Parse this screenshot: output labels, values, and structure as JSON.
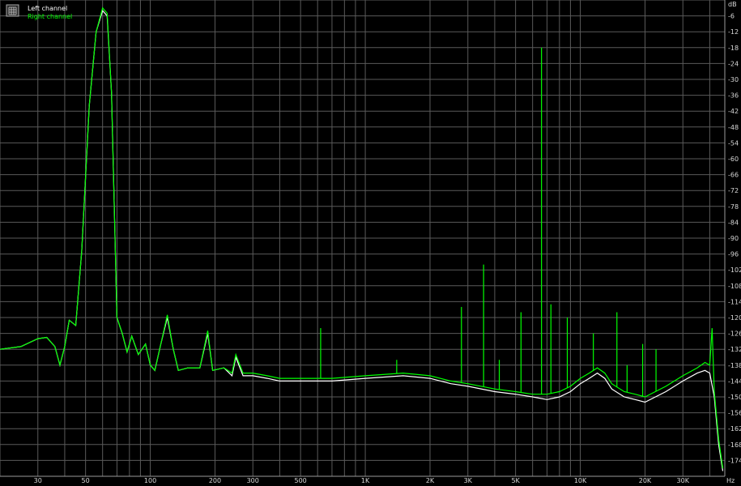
{
  "chart_data": {
    "type": "line",
    "legend": {
      "placement": "top-left",
      "icon": "grid-icon",
      "entries": [
        {
          "name": "Left channel",
          "color": "#ffffff"
        },
        {
          "name": "Right channel",
          "color": "#00ff00"
        }
      ]
    },
    "x_unit": "Hz",
    "y_unit": "dB",
    "x_scale": "log",
    "xlim": [
      20,
      47000
    ],
    "ylim": [
      -180,
      0
    ],
    "grid": true,
    "x_ticks": [
      {
        "value": 30,
        "label": "30"
      },
      {
        "value": 50,
        "label": "50"
      },
      {
        "value": 100,
        "label": "100"
      },
      {
        "value": 200,
        "label": "200"
      },
      {
        "value": 300,
        "label": "300"
      },
      {
        "value": 500,
        "label": "500"
      },
      {
        "value": 1000,
        "label": "1K"
      },
      {
        "value": 2000,
        "label": "2K"
      },
      {
        "value": 3000,
        "label": "3K"
      },
      {
        "value": 5000,
        "label": "5K"
      },
      {
        "value": 10000,
        "label": "10K"
      },
      {
        "value": 20000,
        "label": "20K"
      },
      {
        "value": 30000,
        "label": "30K"
      }
    ],
    "y_ticks": [
      -6,
      -12,
      -18,
      -24,
      -30,
      -36,
      -42,
      -48,
      -54,
      -60,
      -66,
      -72,
      -78,
      -84,
      -90,
      -96,
      -102,
      -108,
      -114,
      -120,
      -126,
      -132,
      -138,
      -144,
      -150,
      -156,
      -162,
      -168,
      -174
    ],
    "series": [
      {
        "name": "Left channel",
        "color": "#ffffff",
        "points": [
          [
            20,
            -132
          ],
          [
            25,
            -131
          ],
          [
            30,
            -128
          ],
          [
            33,
            -127.5
          ],
          [
            36,
            -131
          ],
          [
            38,
            -138
          ],
          [
            40,
            -131
          ],
          [
            42,
            -121
          ],
          [
            45,
            -123
          ],
          [
            48,
            -95
          ],
          [
            52,
            -40
          ],
          [
            56,
            -12
          ],
          [
            60,
            -4
          ],
          [
            63,
            -6
          ],
          [
            66,
            -35
          ],
          [
            70,
            -120
          ],
          [
            74,
            -126
          ],
          [
            78,
            -133
          ],
          [
            82,
            -127
          ],
          [
            88,
            -134
          ],
          [
            95,
            -130
          ],
          [
            100,
            -138
          ],
          [
            105,
            -140
          ],
          [
            112,
            -130
          ],
          [
            120,
            -120
          ],
          [
            128,
            -132
          ],
          [
            135,
            -140
          ],
          [
            150,
            -139
          ],
          [
            170,
            -139
          ],
          [
            185,
            -126
          ],
          [
            195,
            -140
          ],
          [
            220,
            -139
          ],
          [
            240,
            -142
          ],
          [
            250,
            -135
          ],
          [
            270,
            -142
          ],
          [
            300,
            -142
          ],
          [
            350,
            -143
          ],
          [
            400,
            -144
          ],
          [
            500,
            -144
          ],
          [
            700,
            -144
          ],
          [
            1000,
            -143
          ],
          [
            1500,
            -142
          ],
          [
            2000,
            -143
          ],
          [
            2500,
            -145
          ],
          [
            3000,
            -146
          ],
          [
            4000,
            -148
          ],
          [
            5000,
            -149
          ],
          [
            6000,
            -150
          ],
          [
            7000,
            -151
          ],
          [
            8000,
            -150
          ],
          [
            9000,
            -148
          ],
          [
            10000,
            -145
          ],
          [
            11000,
            -143
          ],
          [
            12000,
            -141
          ],
          [
            13000,
            -143
          ],
          [
            14000,
            -147
          ],
          [
            16000,
            -150
          ],
          [
            18000,
            -151
          ],
          [
            20000,
            -152
          ],
          [
            25000,
            -148
          ],
          [
            30000,
            -144
          ],
          [
            35000,
            -141
          ],
          [
            38000,
            -140
          ],
          [
            40000,
            -141
          ],
          [
            42000,
            -150
          ],
          [
            44000,
            -168
          ],
          [
            46000,
            -178
          ]
        ]
      },
      {
        "name": "Right channel",
        "color": "#00ff00",
        "points": [
          [
            20,
            -132
          ],
          [
            25,
            -131
          ],
          [
            30,
            -128
          ],
          [
            33,
            -127.5
          ],
          [
            36,
            -131
          ],
          [
            38,
            -138
          ],
          [
            40,
            -131
          ],
          [
            42,
            -121
          ],
          [
            45,
            -123
          ],
          [
            48,
            -95
          ],
          [
            52,
            -40
          ],
          [
            56,
            -12
          ],
          [
            60,
            -3
          ],
          [
            63,
            -5
          ],
          [
            66,
            -35
          ],
          [
            70,
            -120
          ],
          [
            74,
            -126
          ],
          [
            78,
            -133
          ],
          [
            82,
            -127
          ],
          [
            88,
            -134
          ],
          [
            95,
            -130
          ],
          [
            100,
            -138
          ],
          [
            105,
            -140
          ],
          [
            112,
            -130
          ],
          [
            120,
            -119
          ],
          [
            128,
            -132
          ],
          [
            135,
            -140
          ],
          [
            150,
            -139
          ],
          [
            170,
            -139
          ],
          [
            185,
            -125
          ],
          [
            195,
            -140
          ],
          [
            220,
            -139
          ],
          [
            240,
            -141
          ],
          [
            250,
            -134
          ],
          [
            270,
            -141
          ],
          [
            300,
            -141
          ],
          [
            350,
            -142
          ],
          [
            400,
            -143
          ],
          [
            500,
            -143
          ],
          [
            700,
            -143
          ],
          [
            1000,
            -142
          ],
          [
            1500,
            -141
          ],
          [
            2000,
            -142
          ],
          [
            2500,
            -144
          ],
          [
            3000,
            -145
          ],
          [
            4000,
            -147
          ],
          [
            5000,
            -148
          ],
          [
            6000,
            -149
          ],
          [
            7000,
            -149
          ],
          [
            8000,
            -148
          ],
          [
            9000,
            -146
          ],
          [
            10000,
            -143
          ],
          [
            11000,
            -141
          ],
          [
            12000,
            -139
          ],
          [
            13000,
            -141
          ],
          [
            14000,
            -145
          ],
          [
            16000,
            -148
          ],
          [
            18000,
            -149
          ],
          [
            20000,
            -150
          ],
          [
            25000,
            -146
          ],
          [
            30000,
            -142
          ],
          [
            35000,
            -139
          ],
          [
            38000,
            -137
          ],
          [
            40000,
            -138
          ],
          [
            41000,
            -124
          ],
          [
            42000,
            -148
          ],
          [
            44000,
            -166
          ],
          [
            46000,
            -177
          ]
        ]
      }
    ],
    "spurs": [
      {
        "f": 620,
        "db": -124
      },
      {
        "f": 1400,
        "db": -136
      },
      {
        "f": 2800,
        "db": -116
      },
      {
        "f": 3550,
        "db": -100
      },
      {
        "f": 4200,
        "db": -136
      },
      {
        "f": 5300,
        "db": -118
      },
      {
        "f": 6600,
        "db": -18
      },
      {
        "f": 7300,
        "db": -115
      },
      {
        "f": 8700,
        "db": -120
      },
      {
        "f": 11500,
        "db": -126
      },
      {
        "f": 14800,
        "db": -118
      },
      {
        "f": 16500,
        "db": -138
      },
      {
        "f": 19500,
        "db": -130
      },
      {
        "f": 22500,
        "db": -132
      }
    ]
  }
}
